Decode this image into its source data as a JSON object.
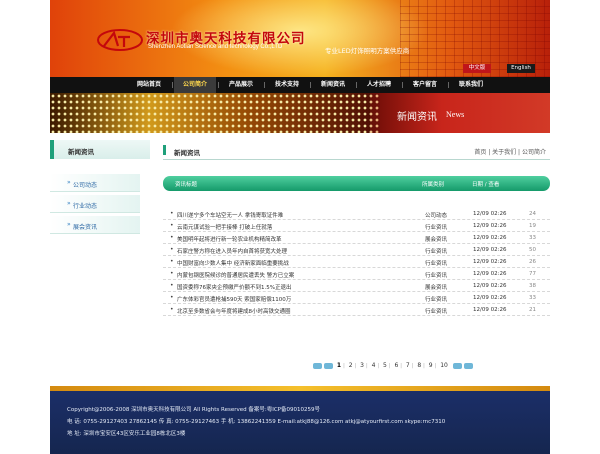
{
  "header": {
    "company_cn": "深圳市奥天科技有限公司",
    "company_en": "Shenzhen Aotian Science and technology Co.,LTD",
    "slogan": "专业LED灯饰照明方案供应商",
    "lang_cn": "中文版",
    "lang_en": "English",
    "brand_color": "#c4070c"
  },
  "nav": {
    "items": [
      "网站首页",
      "公司简介",
      "产品展示",
      "技术支持",
      "新闻资讯",
      "人才招聘",
      "客户留言",
      "联系我们"
    ],
    "active_index": 1
  },
  "banner": {
    "title": "新闻资讯",
    "title_en": "News"
  },
  "sidebar": {
    "heading": "新闻资讯",
    "items": [
      "公司动态",
      "行业动态",
      "展会资讯"
    ]
  },
  "content": {
    "title": "新闻资讯",
    "breadcrumb": "首页 | 关于我们 | 公司简介",
    "columns": {
      "title": "资讯标题",
      "category": "所属类别",
      "date": "日期 / 查看"
    },
    "rows": [
      {
        "title": "四川遂宁多个车站空无一人 拿钱寄取证件难",
        "category": "公司动态",
        "date": "12/09 02:26",
        "views": "24"
      },
      {
        "title": "云南元谋试验一把手接棒 打破上任就落",
        "category": "行业资讯",
        "date": "12/09 02:26",
        "views": "19"
      },
      {
        "title": "美国明年起将进行新一轮农业机构精简改革",
        "category": "展会资讯",
        "date": "12/09 02:26",
        "views": "33"
      },
      {
        "title": "石家庄警方称在进入员年内自首将获宽大处理",
        "category": "行业资讯",
        "date": "12/09 02:26",
        "views": "50"
      },
      {
        "title": "中国财富向少数人集中 经济新家面临重要挑战",
        "category": "行业资讯",
        "date": "12/09 02:26",
        "views": "26"
      },
      {
        "title": "内蒙包钢医院候诊的普通居民遭丢失 警方已立案",
        "category": "行业资讯",
        "date": "12/09 02:26",
        "views": "77"
      },
      {
        "title": "国资委称76家央企预缴严价额不到1.5%正退出",
        "category": "展会资讯",
        "date": "12/09 02:26",
        "views": "38"
      },
      {
        "title": "广东体彩官员遭枪捕590天 索国家赔偿1100万",
        "category": "行业资讯",
        "date": "12/09 02:26",
        "views": "33"
      },
      {
        "title": "北京至多数省会与年度将建成8小时高铁交通圈",
        "category": "行业资讯",
        "date": "12/09 02:26",
        "views": "21"
      }
    ],
    "pager": [
      "1",
      "2",
      "3",
      "4",
      "5",
      "6",
      "7",
      "8",
      "9",
      "10"
    ],
    "current_page": "1"
  },
  "footer": {
    "line1": "Copyright@2006-2008 深圳市奥天科技有限公司 All Rights Reserved   备案号:粤ICP备09010259号",
    "line2": "电 话: 0755-29127403  27862145   传 真: 0755-29127463   手 机: 13862241359    E-mail:atkj88@126.com   atkj@atyourfirst.com        skype:rnc7310",
    "line3": "地 址: 深圳市宝安区43区安乐工业园8栋北区3楼"
  }
}
